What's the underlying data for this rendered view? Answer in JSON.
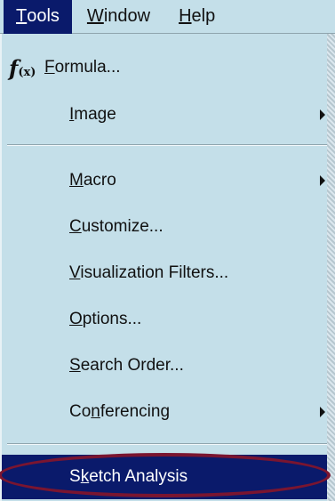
{
  "menubar": {
    "items": [
      {
        "mnemonic": "T",
        "rest": "ools"
      },
      {
        "mnemonic": "W",
        "rest": "indow"
      },
      {
        "mnemonic": "H",
        "rest": "elp"
      }
    ]
  },
  "menu": {
    "formula": {
      "icon": "function-fx-icon",
      "mnemonic": "F",
      "rest": "ormula..."
    },
    "image": {
      "mnemonic": "I",
      "rest": "mage"
    },
    "macro": {
      "mnemonic": "M",
      "rest": "acro"
    },
    "customize": {
      "mnemonic": "C",
      "rest": "ustomize..."
    },
    "visualization_filters": {
      "mnemonic": "V",
      "rest": "isualization Filters..."
    },
    "options": {
      "mnemonic": "O",
      "rest": "ptions..."
    },
    "search_order": {
      "mnemonic": "S",
      "rest": "earch Order..."
    },
    "conferencing": {
      "pre": "Co",
      "mnemonic": "n",
      "rest": "ferencing"
    },
    "sketch_analysis": {
      "pre": "S",
      "mnemonic": "k",
      "rest": "etch Analysis"
    }
  },
  "colors": {
    "menu_bg": "#c4dfe9",
    "highlight_bg": "#0a1a6b",
    "highlight_text": "#ffffff",
    "annotation_ring": "#7a1530"
  }
}
